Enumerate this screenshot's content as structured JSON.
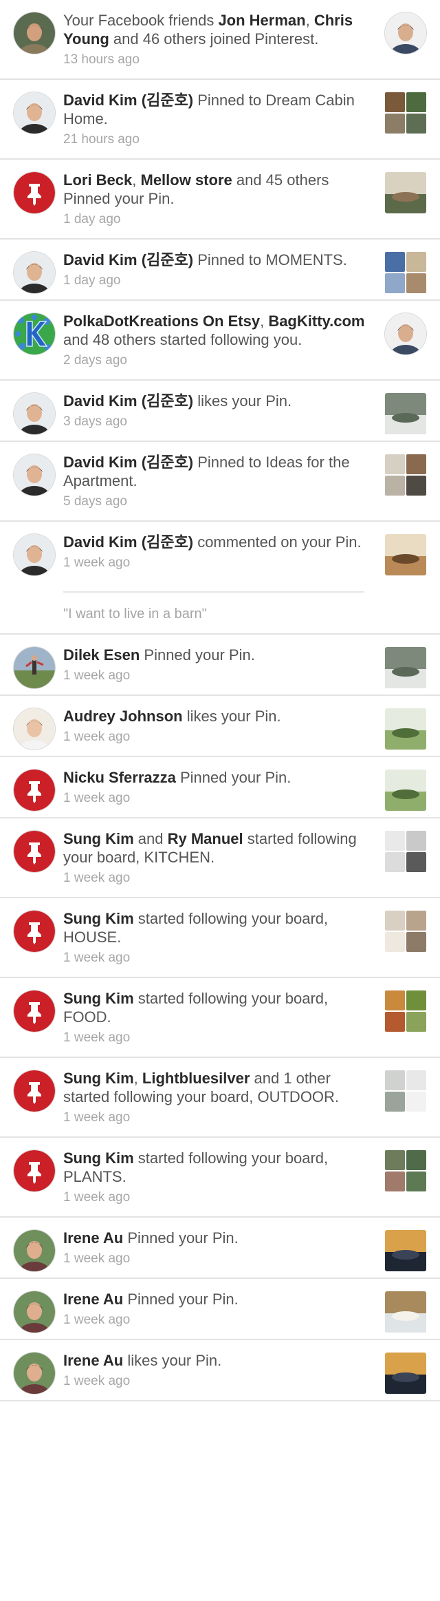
{
  "notifications": [
    {
      "text_before": "Your Facebook friends ",
      "name1": "Jon Herman",
      "mid1": ", ",
      "name2": "Chris Young",
      "rest": " and 46 others joined Pinterest.",
      "time": "13 hours ago",
      "avatar": "man-with-cap",
      "thumb": "profile-photo"
    },
    {
      "name1": "David Kim (김준호)",
      "rest": " Pinned to Dream Cabin Home.",
      "time": "21 hours ago",
      "avatar": "david-kim",
      "thumb": "grid-cabin"
    },
    {
      "name1": "Lori Beck",
      "mid1": ", ",
      "name2": "Mellow store",
      "rest": " and 45 others Pinned your Pin.",
      "time": "1 day ago",
      "avatar": "pinterest-logo",
      "thumb": "patio"
    },
    {
      "name1": "David Kim (김준호)",
      "rest": " Pinned to MOMENTS.",
      "time": "1 day ago",
      "avatar": "david-kim",
      "thumb": "grid-moments"
    },
    {
      "name1": "PolkaDotKreations On Etsy",
      "mid1": ", ",
      "name2": "BagKitty.com",
      "rest": " and 48 others started following you.",
      "time": "2 days ago",
      "avatar": "polka-k-logo",
      "thumb": "profile-photo"
    },
    {
      "name1": "David Kim (김준호)",
      "rest": " likes your Pin.",
      "time": "3 days ago",
      "avatar": "david-kim",
      "thumb": "planter"
    },
    {
      "name1": "David Kim (김준호)",
      "rest": " Pinned to Ideas for the Apartment.",
      "time": "5 days ago",
      "avatar": "david-kim",
      "thumb": "grid-apartment"
    },
    {
      "name1": "David Kim (김준호)",
      "rest": " commented on your Pin.",
      "time": "1 week ago",
      "avatar": "david-kim",
      "thumb": "barn",
      "comment": "\"I want to live in a barn\""
    },
    {
      "name1": "Dilek Esen",
      "rest": " Pinned your Pin.",
      "time": "1 week ago",
      "avatar": "dilek",
      "thumb": "planter"
    },
    {
      "name1": "Audrey Johnson",
      "rest": " likes your Pin.",
      "time": "1 week ago",
      "avatar": "audrey",
      "thumb": "window-plants"
    },
    {
      "name1": "Nicku Sferrazza",
      "rest": " Pinned your Pin.",
      "time": "1 week ago",
      "avatar": "pinterest-logo",
      "thumb": "window-plants"
    },
    {
      "name1": "Sung Kim",
      "mid1": " and ",
      "name2": "Ry Manuel",
      "rest": " started following your board, KITCHEN.",
      "time": "1 week ago",
      "avatar": "pinterest-logo",
      "thumb": "grid-kitchen"
    },
    {
      "name1": "Sung Kim",
      "rest": " started following your board, HOUSE.",
      "time": "1 week ago",
      "avatar": "pinterest-logo",
      "thumb": "grid-house"
    },
    {
      "name1": "Sung Kim",
      "rest": " started following your board, FOOD.",
      "time": "1 week ago",
      "avatar": "pinterest-logo",
      "thumb": "grid-food"
    },
    {
      "name1": "Sung Kim",
      "mid1": ", ",
      "name2": "Lightbluesilver",
      "rest": " and 1 other started following your board, OUTDOOR.",
      "time": "1 week ago",
      "avatar": "pinterest-logo",
      "thumb": "grid-outdoor"
    },
    {
      "name1": "Sung Kim",
      "rest": " started following your board, PLANTS.",
      "time": "1 week ago",
      "avatar": "pinterest-logo",
      "thumb": "grid-plants"
    },
    {
      "name1": "Irene Au",
      "rest": " Pinned your Pin.",
      "time": "1 week ago",
      "avatar": "irene",
      "thumb": "night-house"
    },
    {
      "name1": "Irene Au",
      "rest": " Pinned your Pin.",
      "time": "1 week ago",
      "avatar": "irene",
      "thumb": "bright-room"
    },
    {
      "name1": "Irene Au",
      "rest": " likes your Pin.",
      "time": "1 week ago",
      "avatar": "irene",
      "thumb": "night-house"
    }
  ],
  "colors": {
    "pinterest_red": "#cb2027",
    "divider": "#e3e3e3",
    "name": "#2a2a2a",
    "body_text": "#555555",
    "timestamp": "#a6a6a6"
  }
}
